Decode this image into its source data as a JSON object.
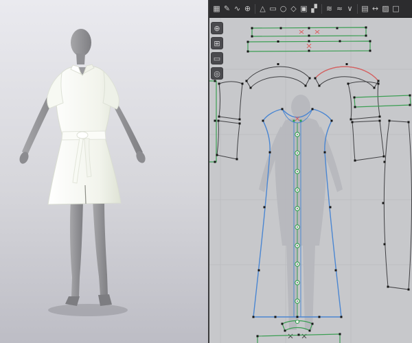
{
  "colors": {
    "toolbar_bg": "#2c2c2e",
    "toolbar_icon": "#c9c9c9",
    "panel_divider": "#3a3a3c",
    "canvas_bg": "#c7c8cb",
    "grid_line": "#b9babe",
    "silhouette": "#b7b8bd",
    "piece_fill": "#e9ece5",
    "pattern_blue": "#4a86d2",
    "pattern_green": "#3a9e52",
    "outline_dark": "#3f3f42",
    "point_black": "#161616",
    "point_green": "#2e9e4e",
    "seam_red": "#d95f5f",
    "viewport_top": "#e9e9ee",
    "viewport_bottom": "#bdbdc5",
    "avatar_skin": "#97979b",
    "garment_white": "#f5f7f1"
  },
  "toolbar": {
    "icons": [
      {
        "name": "transform-pattern",
        "glyph": "▦"
      },
      {
        "name": "edit-pattern",
        "glyph": "✎"
      },
      {
        "name": "edit-curvature",
        "glyph": "∿"
      },
      {
        "name": "add-point",
        "glyph": "⊕"
      },
      {
        "sep": true
      },
      {
        "name": "polygon",
        "glyph": "△"
      },
      {
        "name": "rectangle",
        "glyph": "▭"
      },
      {
        "name": "circle",
        "glyph": "○"
      },
      {
        "name": "dart",
        "glyph": "◇"
      },
      {
        "name": "internal-shape",
        "glyph": "▣"
      },
      {
        "name": "trace",
        "glyph": "▞"
      },
      {
        "sep": true
      },
      {
        "name": "segment-sewing",
        "glyph": "≋"
      },
      {
        "name": "free-sewing",
        "glyph": "≈"
      },
      {
        "name": "notch",
        "glyph": "∨"
      },
      {
        "sep": true
      },
      {
        "name": "grading",
        "glyph": "▤"
      },
      {
        "name": "measure",
        "glyph": "↔"
      },
      {
        "name": "texture",
        "glyph": "▨"
      },
      {
        "name": "flatten",
        "glyph": "□"
      }
    ]
  },
  "side_tools": {
    "icons": [
      {
        "name": "zoom-tool",
        "glyph": "⊕"
      },
      {
        "name": "pan-tool",
        "glyph": "⊞"
      },
      {
        "name": "box-select-tool",
        "glyph": "▭"
      },
      {
        "name": "focus-tool",
        "glyph": "◎"
      }
    ]
  },
  "pattern": {
    "placket_button_count": 10,
    "pieces": [
      "waist-tie-strap-1",
      "waist-tie-strap-2",
      "sleeve-cap-left",
      "sleeve-cap-right",
      "bodice-back-left-upper",
      "bodice-back-left-lower",
      "bodice-back-right-upper",
      "bodice-back-right-lower",
      "front-facing-strip",
      "skirt-side-panel",
      "dress-front-panel",
      "hem-facing",
      "hem-strip",
      "left-edge-strip"
    ]
  }
}
